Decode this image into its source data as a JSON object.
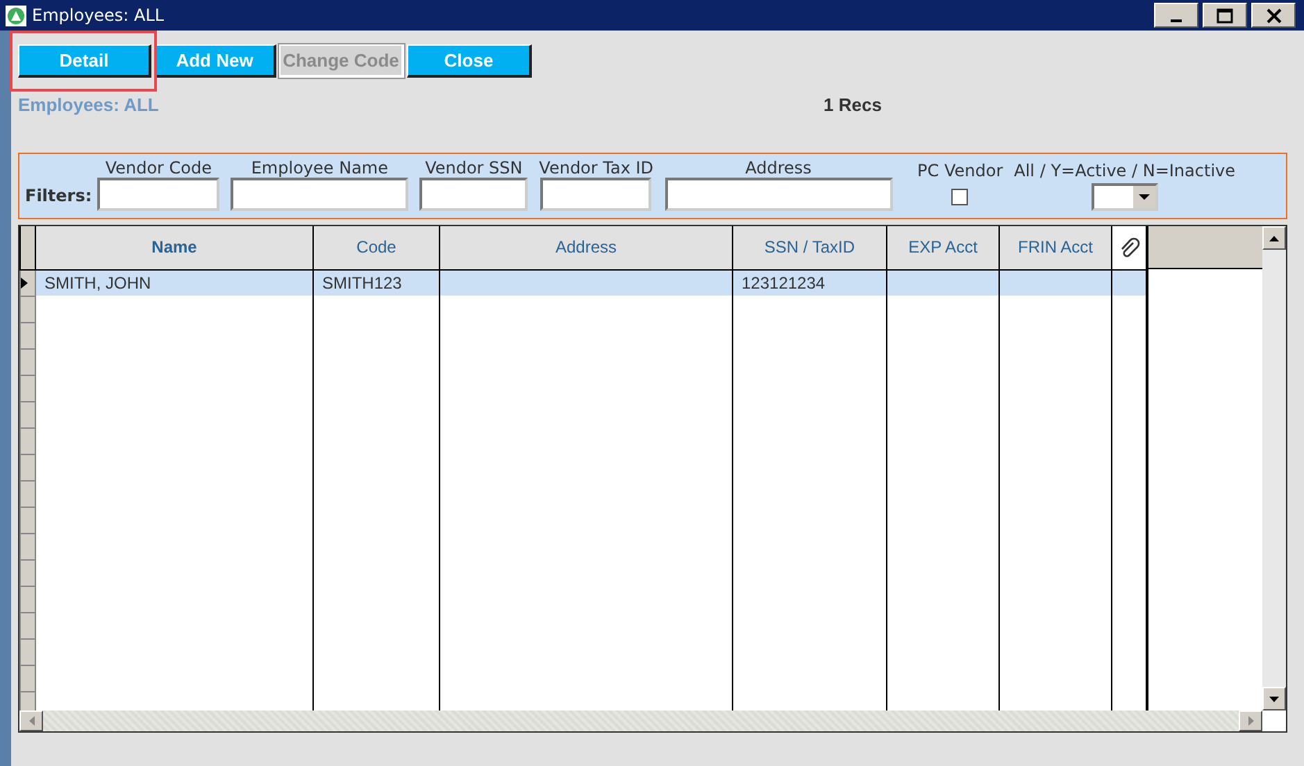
{
  "window": {
    "title": "Employees: ALL"
  },
  "toolbar": [
    {
      "label": "Detail",
      "disabled": false,
      "highlighted": true
    },
    {
      "label": "Add New",
      "disabled": false,
      "highlighted": false
    },
    {
      "label": "Change Code",
      "disabled": true,
      "highlighted": false
    },
    {
      "label": "Close",
      "disabled": false,
      "highlighted": false
    }
  ],
  "heading": "Employees: ALL",
  "record_count": "1 Recs",
  "filters": {
    "label": "Filters:",
    "fields": [
      {
        "kind": "text",
        "label": "Vendor Code"
      },
      {
        "kind": "text",
        "label": "Employee Name"
      },
      {
        "kind": "text",
        "label": "Vendor SSN"
      },
      {
        "kind": "text",
        "label": "Vendor Tax ID"
      },
      {
        "kind": "text",
        "label": "Address"
      },
      {
        "kind": "checkbox",
        "label": "PC Vendor",
        "checked": false
      },
      {
        "kind": "select",
        "label": "All / Y=Active / N=Inactive"
      }
    ]
  },
  "table": {
    "columns": [
      {
        "label": "Name",
        "bold": true
      },
      {
        "label": "Code",
        "bold": false
      },
      {
        "label": "Address",
        "bold": false
      },
      {
        "label": "SSN / TaxID",
        "bold": false
      },
      {
        "label": "EXP Acct",
        "bold": false
      },
      {
        "label": "FRIN Acct",
        "bold": false
      },
      {
        "kind": "attachment"
      }
    ],
    "rows": [
      {
        "selected": true,
        "cells": [
          "SMITH, JOHN",
          "SMITH123",
          "",
          "123121234",
          "",
          "",
          ""
        ]
      }
    ]
  }
}
